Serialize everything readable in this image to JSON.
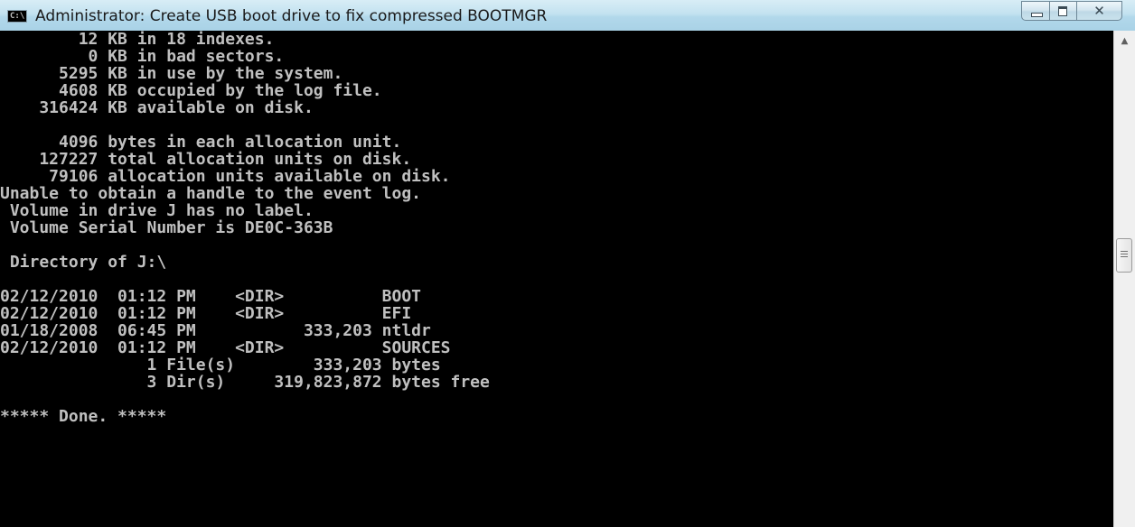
{
  "window": {
    "title": "Administrator:  Create USB boot drive to fix compressed BOOTMGR",
    "icon_text": "C:\\"
  },
  "colors": {
    "console_background": "#000000",
    "console_text": "#c0c0c0",
    "titlebar": "#b2d8eb"
  },
  "icons": {
    "title_icon": "cmd-icon",
    "minimize": "minimize-icon",
    "maximize": "maximize-icon",
    "close": "close-icon",
    "scroll_up": "scroll-up-arrow-icon",
    "scroll_thumb": "scroll-thumb-grip-icon"
  },
  "caption_buttons": {
    "close_glyph": "✕"
  },
  "console": {
    "lines": [
      "        12 KB in 18 indexes.",
      "         0 KB in bad sectors.",
      "      5295 KB in use by the system.",
      "      4608 KB occupied by the log file.",
      "    316424 KB available on disk.",
      "",
      "      4096 bytes in each allocation unit.",
      "    127227 total allocation units on disk.",
      "     79106 allocation units available on disk.",
      "Unable to obtain a handle to the event log.",
      " Volume in drive J has no label.",
      " Volume Serial Number is DE0C-363B",
      "",
      " Directory of J:\\",
      "",
      "02/12/2010  01:12 PM    <DIR>          BOOT",
      "02/12/2010  01:12 PM    <DIR>          EFI",
      "01/18/2008  06:45 PM           333,203 ntldr",
      "02/12/2010  01:12 PM    <DIR>          SOURCES",
      "               1 File(s)        333,203 bytes",
      "               3 Dir(s)     319,823,872 bytes free",
      "",
      "***** Done. *****"
    ]
  }
}
